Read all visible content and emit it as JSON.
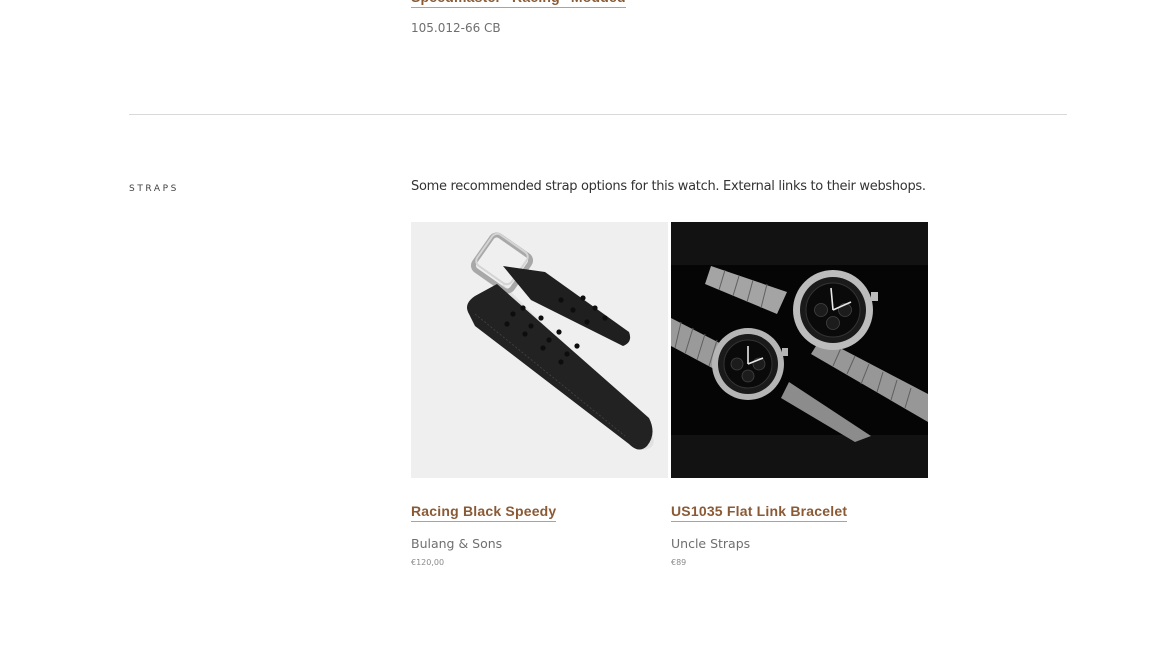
{
  "previous_item": {
    "title": "Speedmaster \"Racing\" Modded",
    "reference": "105.012-66 CB"
  },
  "straps_section": {
    "label": "STRAPS",
    "description": "Some recommended strap options for this watch. External links to their webshops."
  },
  "straps": [
    {
      "title": "Racing Black Speedy",
      "brand": "Bulang & Sons",
      "price": "€120,00",
      "image": "black-racing-leather-strap-photo"
    },
    {
      "title": "US1035 Flat Link Bracelet",
      "brand": "Uncle Straps",
      "price": "€89",
      "image": "two-speedmaster-watches-on-steel-bracelets-photo"
    }
  ],
  "colors": {
    "link": "#8a5a35",
    "link_underline": "#c79a79",
    "muted_text": "#6f6f6f",
    "divider": "#d9d9d9"
  }
}
